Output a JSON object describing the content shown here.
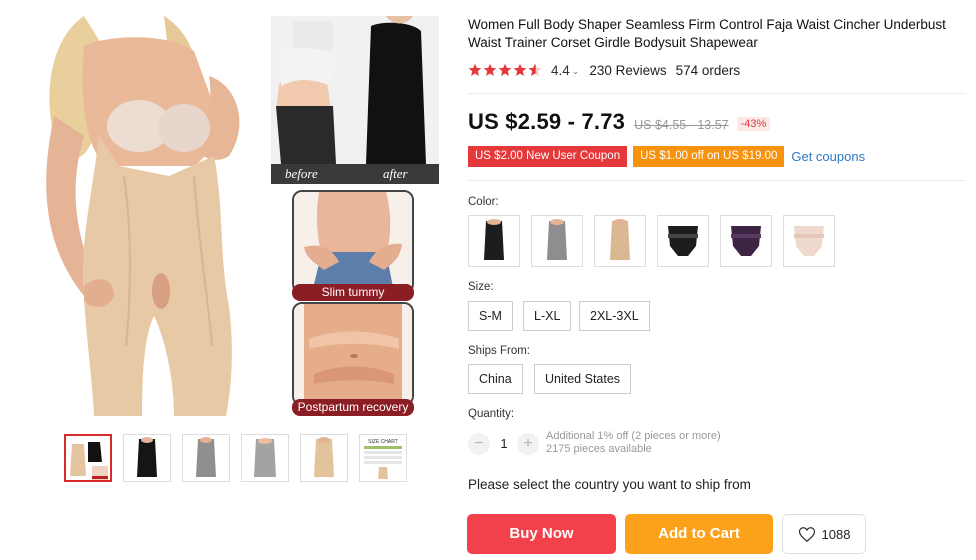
{
  "product": {
    "title": "Women Full Body Shaper Seamless Firm Control Faja Waist Cincher Underbust Waist Trainer Corset Girdle Bodysuit Shapewear",
    "rating": "4.4",
    "rating_value": 4.4,
    "reviews": "230 Reviews",
    "orders": "574 orders",
    "price": "US $2.59 - 7.73",
    "original_price": "US $4.55 - 13.57",
    "discount": "-43%"
  },
  "gallery": {
    "before_label": "before",
    "after_label": "after",
    "card1_label": "Slim tummy",
    "card2_label": "Postpartum recovery",
    "size_chart_label": "SIZE CHART",
    "thumbnails": [
      {
        "name": "nude-black-combo"
      },
      {
        "name": "black"
      },
      {
        "name": "grey"
      },
      {
        "name": "grey-alt"
      },
      {
        "name": "nude"
      },
      {
        "name": "size-chart"
      }
    ]
  },
  "coupons": {
    "new_user": "US $2.00 New User Coupon",
    "store": "US $1.00 off on US $19.00",
    "get_coupons": "Get coupons"
  },
  "color": {
    "label": "Color:",
    "options": [
      {
        "name": "black-bodysuit",
        "color": "#1d1d1d"
      },
      {
        "name": "grey-bodysuit",
        "color": "#8e8e8e"
      },
      {
        "name": "nude-bodysuit",
        "color": "#d9b892"
      },
      {
        "name": "black-brief",
        "color": "#1d1d1d"
      },
      {
        "name": "purple-brief",
        "color": "#3e2443"
      },
      {
        "name": "beige-brief",
        "color": "#efd8cc"
      }
    ]
  },
  "size": {
    "label": "Size:",
    "options": [
      "S-M",
      "L-XL",
      "2XL-3XL"
    ]
  },
  "ships_from": {
    "label": "Ships From:",
    "options": [
      "China",
      "United States"
    ]
  },
  "quantity": {
    "label": "Quantity:",
    "minus": "−",
    "plus": "+",
    "value": "1",
    "discount_note": "Additional 1% off (2 pieces or more)",
    "available": "2175 pieces available"
  },
  "shipping_message": "Please select the country you want to ship from",
  "actions": {
    "buy_now": "Buy Now",
    "add_to_cart": "Add to Cart",
    "wishlist_count": "1088"
  },
  "colors": {
    "buy_now": "#f2414a",
    "add_to_cart": "#fba21a",
    "coupon_red": "#e5383b",
    "coupon_orange": "#f7920e",
    "link": "#2b78c5",
    "star": "#e5383b"
  }
}
